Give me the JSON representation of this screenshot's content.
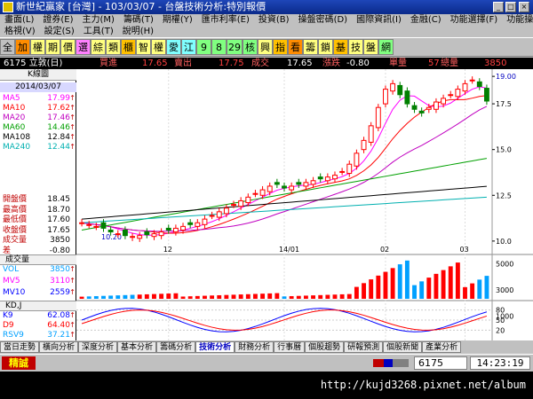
{
  "window": {
    "title": "新世紀贏家 [台灣] - 103/03/07 - 台盤技術分析:特別報價"
  },
  "menu1": [
    "畫面(L)",
    "證券(E)",
    "主力(M)",
    "籌碼(T)",
    "期權(Y)",
    "匯市利率(E)",
    "投資(B)",
    "操盤密碼(D)",
    "國際資訊(I)",
    "金融(C)",
    "功能選擇(F)",
    "功能操作(E)"
  ],
  "menu2": [
    "格視(V)",
    "設定(S)",
    "工具(T)",
    "說明(H)"
  ],
  "toolbar": [
    "全",
    "加",
    "權",
    "期",
    "價",
    "選",
    "綜",
    "類",
    "櫃",
    "智",
    "權",
    "愛",
    "江",
    "9",
    "8",
    "29",
    "核",
    "興",
    "指",
    "看",
    "籌",
    "鎖",
    "基",
    "技",
    "盤",
    "網"
  ],
  "quote": {
    "symbol": "6175 立敦(日)",
    "buy_label": "買進",
    "buy": "17.65",
    "sell_label": "賣出",
    "sell": "17.75",
    "deal_label": "成交",
    "deal": "17.65",
    "change_label": "漲跌",
    "change": "-0.80",
    "vol_label": "單量",
    "vol": "57",
    "total_label": "總量",
    "total": "3850"
  },
  "panel": {
    "title": "K線圖",
    "date": "2014/03/07",
    "ma": [
      {
        "label": "MA5",
        "value": "17.99",
        "color": "#ff00ff"
      },
      {
        "label": "MA10",
        "value": "17.62",
        "color": "#ff0000"
      },
      {
        "label": "MA20",
        "value": "17.46",
        "color": "#c000c0"
      },
      {
        "label": "MA60",
        "value": "14.46",
        "color": "#00a000"
      },
      {
        "label": "MA108",
        "value": "12.84",
        "color": "#000000"
      },
      {
        "label": "MA240",
        "value": "12.44",
        "color": "#00b0b0"
      }
    ],
    "ohlc": [
      {
        "label": "開盤價",
        "value": "18.45"
      },
      {
        "label": "最高價",
        "value": "18.70"
      },
      {
        "label": "最低價",
        "value": "17.60"
      },
      {
        "label": "收盤價",
        "value": "17.65"
      },
      {
        "label": "成交量",
        "value": "3850"
      },
      {
        "label": "差",
        "value": "-0.80"
      }
    ],
    "vol_title": "成交量",
    "vol": [
      {
        "label": "VOL",
        "value": "3850",
        "color": "#00a0ff"
      },
      {
        "label": "MV5",
        "value": "3110",
        "color": "#ff00ff"
      },
      {
        "label": "MV10",
        "value": "2559",
        "color": "#0000ff"
      }
    ],
    "kd_title": "KD,J",
    "kd": [
      {
        "label": "K9",
        "value": "62.08",
        "color": "#0000ff"
      },
      {
        "label": "D9",
        "value": "64.40",
        "color": "#ff0000"
      },
      {
        "label": "RSV9",
        "value": "37.21",
        "color": "#00a0ff"
      }
    ]
  },
  "axes": {
    "price_ticks": [
      "19.00",
      "17.5",
      "15.0",
      "12.5",
      "10.0"
    ],
    "x_ticks": [
      "12",
      "14/01",
      "02",
      "03"
    ],
    "low_label": "10.20",
    "vol_ticks": [
      "5000",
      "3000",
      "1000"
    ],
    "kd_ticks": [
      "80",
      "50",
      "20"
    ]
  },
  "tabs": [
    "當日走勢",
    "橫向分析",
    "深度分析",
    "基本分析",
    "籌碼分析",
    "技術分析",
    "財務分析",
    "行事曆",
    "個股趨勢",
    "研報預測",
    "個股新聞",
    "產業分析"
  ],
  "tab_selected": 5,
  "status": {
    "mode": "精誠",
    "code": "6175",
    "time": "14:23:19"
  },
  "watermark": "http://kujd3268.pixnet.net/album",
  "chart_data": {
    "type": "candlestick",
    "closes": [
      11.0,
      10.9,
      10.8,
      10.7,
      10.5,
      10.4,
      10.3,
      10.25,
      10.3,
      10.35,
      10.4,
      10.5,
      10.6,
      10.7,
      10.8,
      10.9,
      11.0,
      11.2,
      11.4,
      11.6,
      11.8,
      12.0,
      12.2,
      12.4,
      12.6,
      12.8,
      13.0,
      13.1,
      12.9,
      13.0,
      13.1,
      13.2,
      13.3,
      13.4,
      13.5,
      13.6,
      13.8,
      14.2,
      14.8,
      15.5,
      16.3,
      17.3,
      18.3,
      18.6,
      18.0,
      17.5,
      17.2,
      17.0,
      17.3,
      17.6,
      17.8,
      18.0,
      18.3,
      18.6,
      18.8,
      18.45,
      17.65
    ],
    "ylim": [
      9.8,
      19.2
    ]
  }
}
